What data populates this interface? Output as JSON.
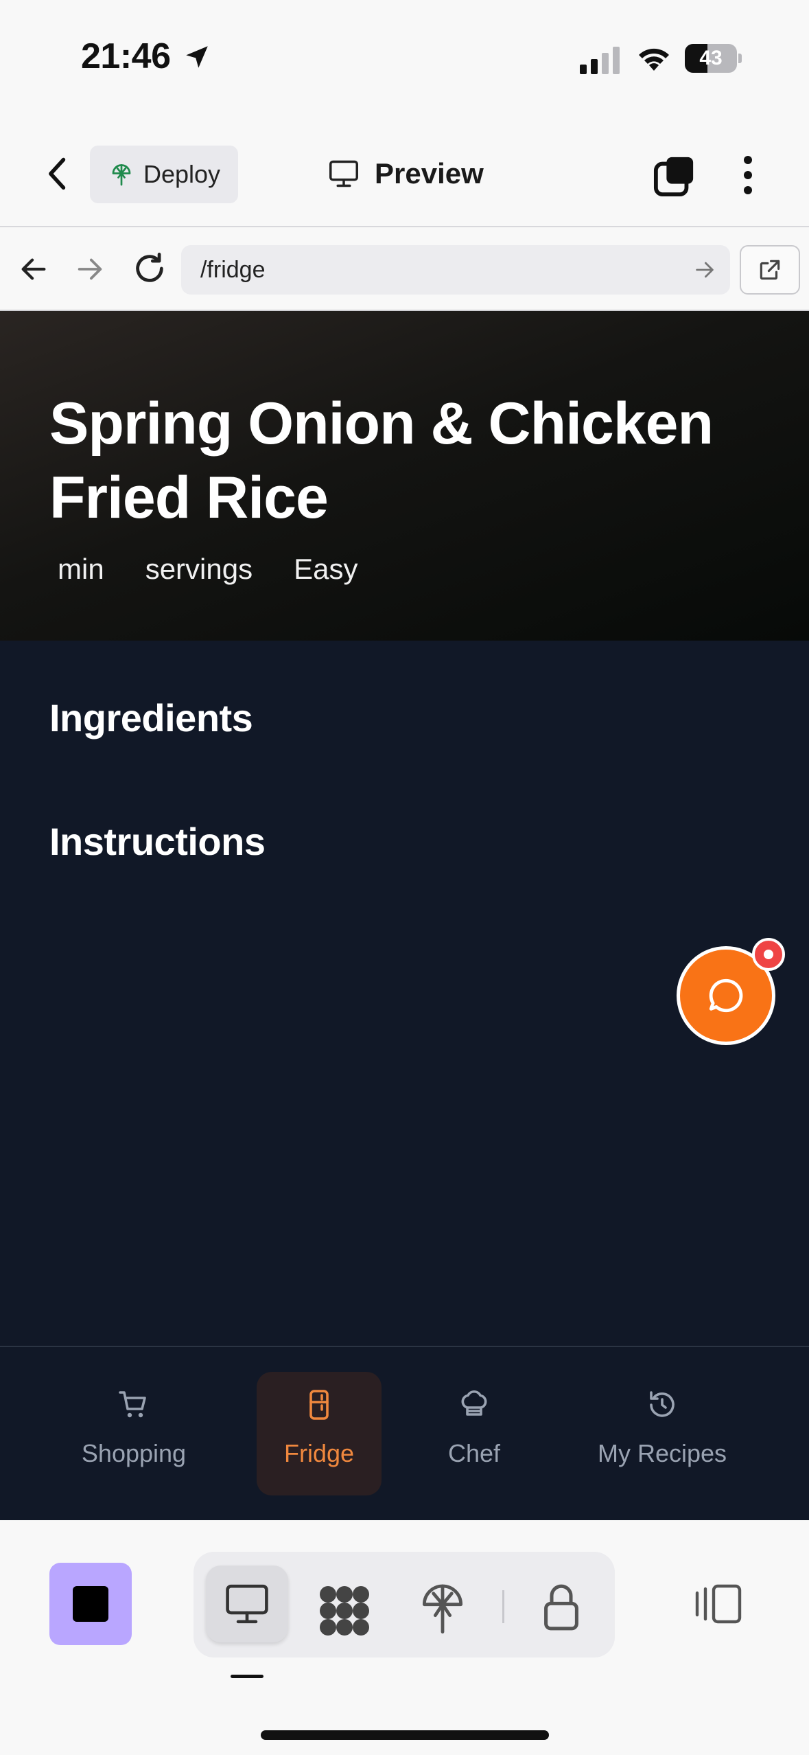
{
  "status_bar": {
    "time": "21:46",
    "battery": "43",
    "battery_level": 0.43
  },
  "header": {
    "deploy_label": "Deploy",
    "preview_label": "Preview"
  },
  "browser": {
    "url": "/fridge"
  },
  "recipe": {
    "title": "Spring Onion & Chicken Fried Rice",
    "time": "min",
    "servings": "servings",
    "difficulty": "Easy",
    "ingredients_heading": "Ingredients",
    "instructions_heading": "Instructions"
  },
  "bottom_nav": {
    "active": "Fridge",
    "tabs": [
      {
        "label": "Shopping",
        "icon": "cart-icon"
      },
      {
        "label": "Fridge",
        "icon": "fridge-icon"
      },
      {
        "label": "Chef",
        "icon": "chef-hat-icon"
      },
      {
        "label": "My Recipes",
        "icon": "history-icon"
      }
    ]
  },
  "colors": {
    "accent": "#f97316",
    "content_bg": "#111827",
    "notification": "#ef4444",
    "stop_button": "#b9a6ff"
  }
}
